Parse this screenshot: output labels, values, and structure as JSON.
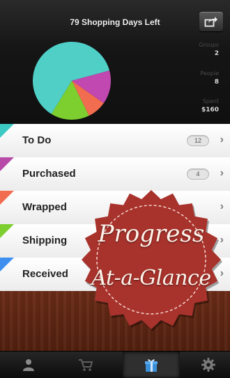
{
  "header": {
    "title": "79 Shopping Days Left",
    "share_icon": "share-icon",
    "stats": [
      {
        "label": "Groups",
        "value": "2"
      },
      {
        "label": "People",
        "value": "8"
      },
      {
        "label": "Spent",
        "value": "$160"
      }
    ]
  },
  "pie_chart": {
    "slices": [
      {
        "color": "#4fcfc6",
        "fraction": 0.62
      },
      {
        "color": "#c148b0",
        "fraction": 0.14
      },
      {
        "color": "#f26c4f",
        "fraction": 0.08
      },
      {
        "color": "#7ccf2f",
        "fraction": 0.16
      }
    ]
  },
  "list": {
    "rows": [
      {
        "label": "To Do",
        "badge": "12",
        "color": "#3ccbc2"
      },
      {
        "label": "Purchased",
        "badge": "4",
        "color": "#b84aa8"
      },
      {
        "label": "Wrapped",
        "badge": "",
        "color": "#f26c4f"
      },
      {
        "label": "Shipping",
        "badge": "",
        "color": "#7ccf2f"
      },
      {
        "label": "Received",
        "badge": "",
        "color": "#3d8ff0"
      }
    ],
    "chevron": "›"
  },
  "promo": {
    "line1": "Progress",
    "line2": "At-a-Glance",
    "seal_color": "#a8322c"
  },
  "tabbar": {
    "tabs": [
      {
        "icon": "person-icon"
      },
      {
        "icon": "cart-icon"
      },
      {
        "icon": "gift-icon"
      },
      {
        "icon": "gear-icon"
      }
    ]
  }
}
